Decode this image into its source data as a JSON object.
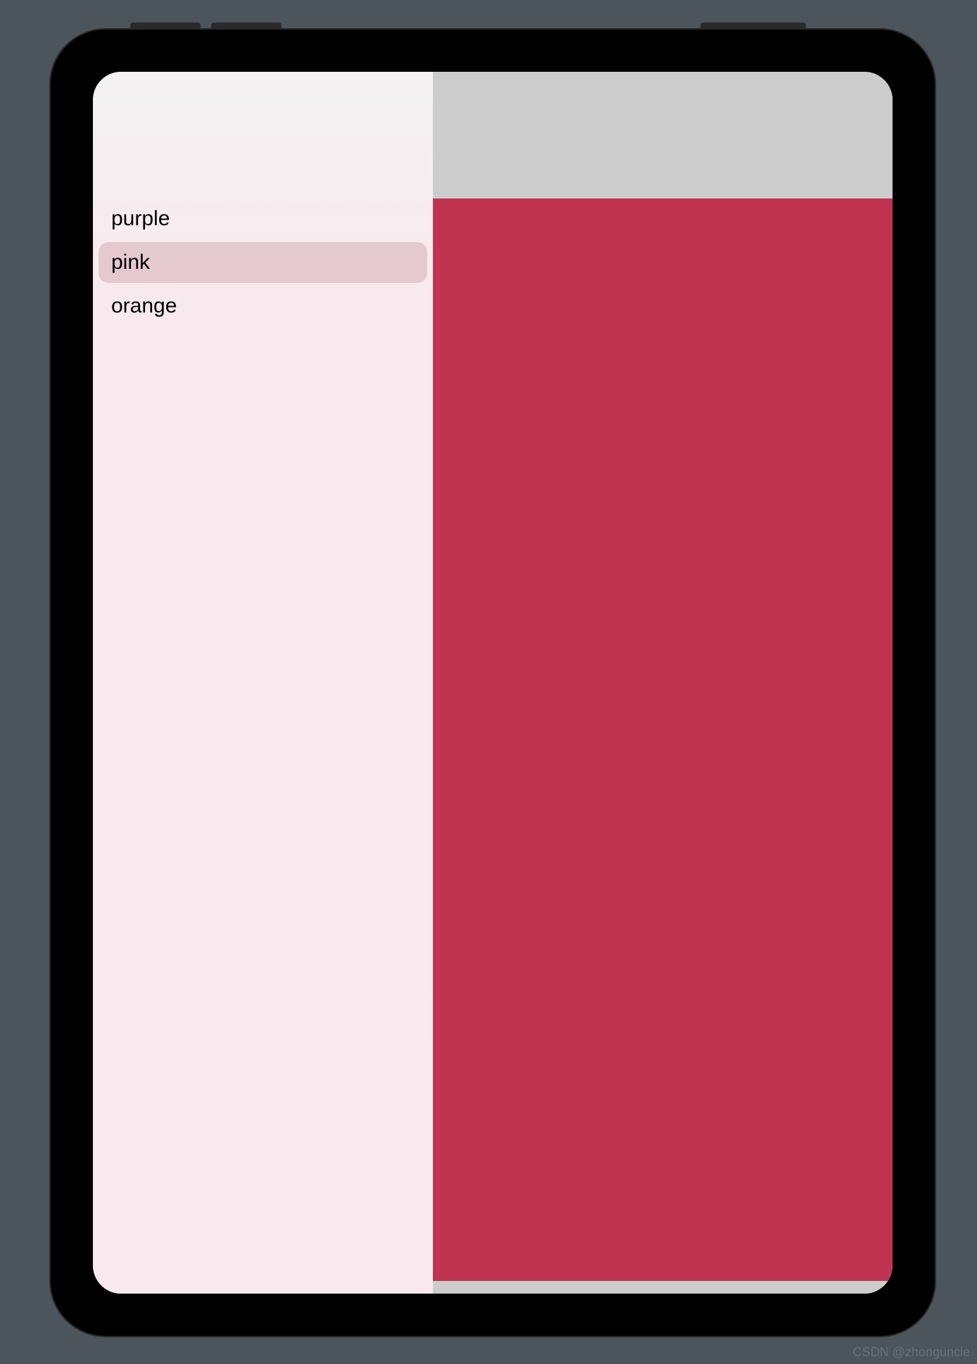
{
  "sidebar": {
    "items": [
      {
        "label": "purple",
        "selected": false
      },
      {
        "label": "pink",
        "selected": true
      },
      {
        "label": "orange",
        "selected": false
      }
    ]
  },
  "detail": {
    "selected_color": "#c03452"
  },
  "watermark": "CSDN @zhonguncle"
}
